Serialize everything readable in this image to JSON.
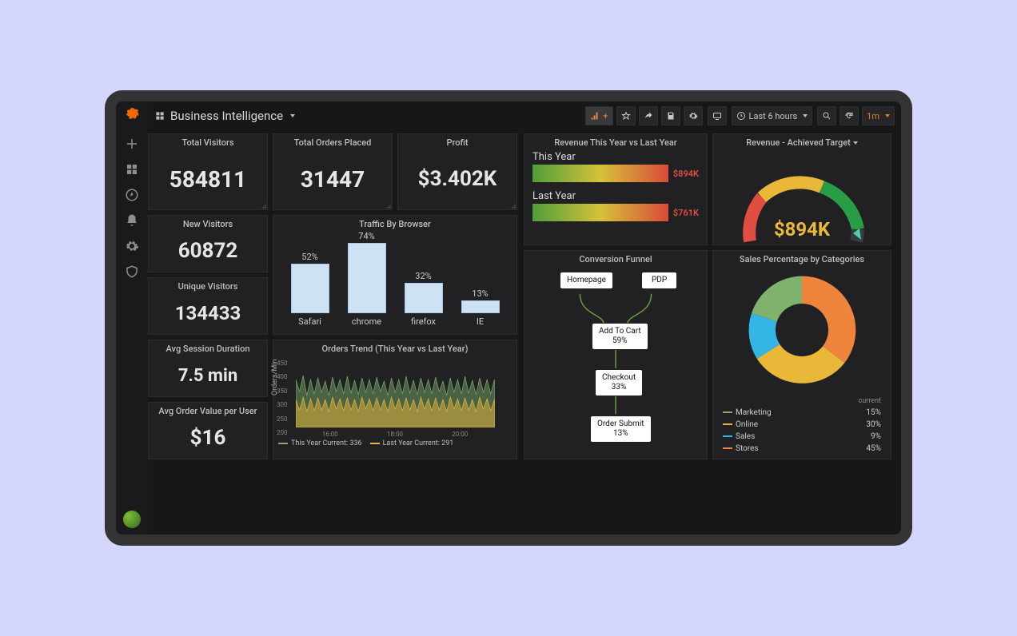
{
  "app": {
    "title": "Business Intelligence"
  },
  "toolbar": {
    "time_range": "Last 6 hours",
    "refresh_interval": "1m"
  },
  "panels": {
    "total_visitors": {
      "title": "Total Visitors",
      "value": "584811"
    },
    "total_orders": {
      "title": "Total Orders Placed",
      "value": "31447"
    },
    "profit": {
      "title": "Profit",
      "value": "$3.402K"
    },
    "new_visitors": {
      "title": "New Visitors",
      "value": "60872"
    },
    "unique_visitors": {
      "title": "Unique Visitors",
      "value": "134433"
    },
    "avg_session": {
      "title": "Avg Session Duration",
      "value": "7.5 min"
    },
    "avg_order_value": {
      "title": "Avg Order Value per User",
      "value": "$16"
    },
    "traffic_browser": {
      "title": "Traffic By Browser"
    },
    "orders_trend": {
      "title": "Orders Trend (This Year vs Last Year)",
      "ylabel": "Orders/Min",
      "legend_a": "This Year  Current: 336",
      "legend_b": "Last Year  Current: 291"
    },
    "revenue_compare": {
      "title": "Revenue This Year vs Last Year",
      "this_label": "This Year",
      "this_value": "$894K",
      "last_label": "Last Year",
      "last_value": "$761K"
    },
    "revenue_target": {
      "title": "Revenue - Achieved Target",
      "value": "$894K"
    },
    "funnel": {
      "title": "Conversion Funnel",
      "homepage": "Homepage",
      "pdp": "PDP",
      "add_to_cart": "Add To Cart",
      "add_pct": "59%",
      "checkout": "Checkout",
      "checkout_pct": "33%",
      "submit": "Order Submit",
      "submit_pct": "13%"
    },
    "sales_cat": {
      "title": "Sales Percentage by Categories",
      "legend_header": "current",
      "cats": {
        "marketing": {
          "label": "Marketing",
          "value": "15%"
        },
        "online": {
          "label": "Online",
          "value": "30%"
        },
        "sales": {
          "label": "Sales",
          "value": "9%"
        },
        "stores": {
          "label": "Stores",
          "value": "45%"
        }
      }
    }
  },
  "chart_data": [
    {
      "id": "traffic_by_browser",
      "type": "bar",
      "categories": [
        "Safari",
        "chrome",
        "firefox",
        "IE"
      ],
      "values": [
        52,
        74,
        32,
        13
      ],
      "title": "Traffic By Browser",
      "ylabel": "%",
      "ylim": [
        0,
        100
      ]
    },
    {
      "id": "revenue_year_compare",
      "type": "bar",
      "orientation": "horizontal",
      "categories": [
        "This Year",
        "Last Year"
      ],
      "values": [
        894,
        761
      ],
      "unit": "$K",
      "title": "Revenue This Year vs Last Year"
    },
    {
      "id": "revenue_target_gauge",
      "type": "gauge",
      "value": 894,
      "unit": "$K",
      "min": 0,
      "max": 1000,
      "thresholds": [
        {
          "color": "#e24d42",
          "to": 300
        },
        {
          "color": "#eab839",
          "to": 700
        },
        {
          "color": "#299c46",
          "to": 1000
        }
      ],
      "title": "Revenue - Achieved Target"
    },
    {
      "id": "sales_by_category",
      "type": "pie",
      "donut": true,
      "series": [
        {
          "name": "Marketing",
          "value": 15,
          "color": "#7eb26d"
        },
        {
          "name": "Online",
          "value": 30,
          "color": "#eab839"
        },
        {
          "name": "Sales",
          "value": 9,
          "color": "#33b5e5"
        },
        {
          "name": "Stores",
          "value": 45,
          "color": "#ef843c"
        }
      ],
      "title": "Sales Percentage by Categories"
    },
    {
      "id": "conversion_funnel",
      "type": "funnel",
      "stages": [
        {
          "name": "Homepage"
        },
        {
          "name": "PDP"
        },
        {
          "name": "Add To Cart",
          "pct": 59
        },
        {
          "name": "Checkout",
          "pct": 33
        },
        {
          "name": "Order Submit",
          "pct": 13
        }
      ],
      "title": "Conversion Funnel"
    },
    {
      "id": "orders_trend",
      "type": "line",
      "title": "Orders Trend (This Year vs Last Year)",
      "ylabel": "Orders/Min",
      "ylim": [
        200,
        450
      ],
      "x_ticks": [
        "16:00",
        "18:00",
        "20:00"
      ],
      "series": [
        {
          "name": "This Year",
          "color": "#7eb26d",
          "current": 336
        },
        {
          "name": "Last Year",
          "color": "#eab839",
          "current": 291
        }
      ]
    }
  ]
}
